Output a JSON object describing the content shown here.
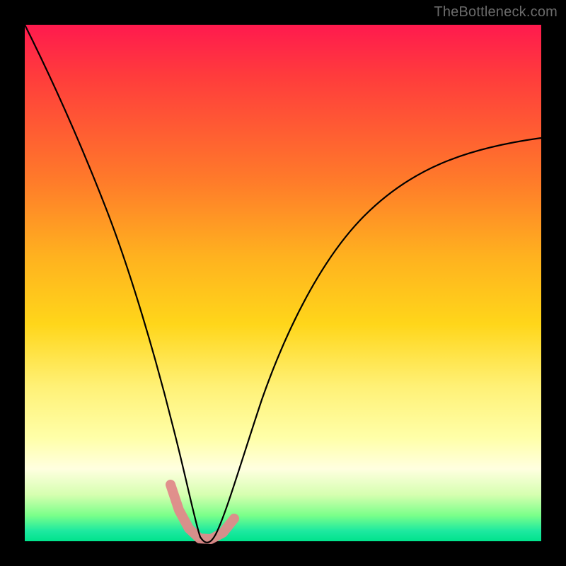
{
  "watermark": "TheBottleneck.com",
  "chart_data": {
    "type": "line",
    "title": "",
    "xlabel": "",
    "ylabel": "",
    "xlim": [
      0,
      1
    ],
    "ylim": [
      0,
      1
    ],
    "background_gradient": {
      "top_color": "#ff1a4e",
      "bottom_color": "#00e38c",
      "stops": [
        "red",
        "orange",
        "yellow",
        "pale-yellow",
        "green"
      ]
    },
    "series": [
      {
        "name": "bottleneck-curve",
        "x": [
          0.0,
          0.03,
          0.06,
          0.1,
          0.14,
          0.18,
          0.22,
          0.26,
          0.3,
          0.32,
          0.34,
          0.36,
          0.4,
          0.44,
          0.5,
          0.58,
          0.66,
          0.74,
          0.82,
          0.9,
          1.0
        ],
        "y": [
          1.0,
          0.92,
          0.83,
          0.72,
          0.6,
          0.48,
          0.36,
          0.23,
          0.1,
          0.04,
          0.0,
          0.02,
          0.1,
          0.23,
          0.38,
          0.52,
          0.6,
          0.66,
          0.71,
          0.75,
          0.78
        ]
      }
    ],
    "highlight_band": {
      "name": "optimal-range",
      "xrange": [
        0.28,
        0.4
      ],
      "color": "#e08a8a"
    }
  }
}
